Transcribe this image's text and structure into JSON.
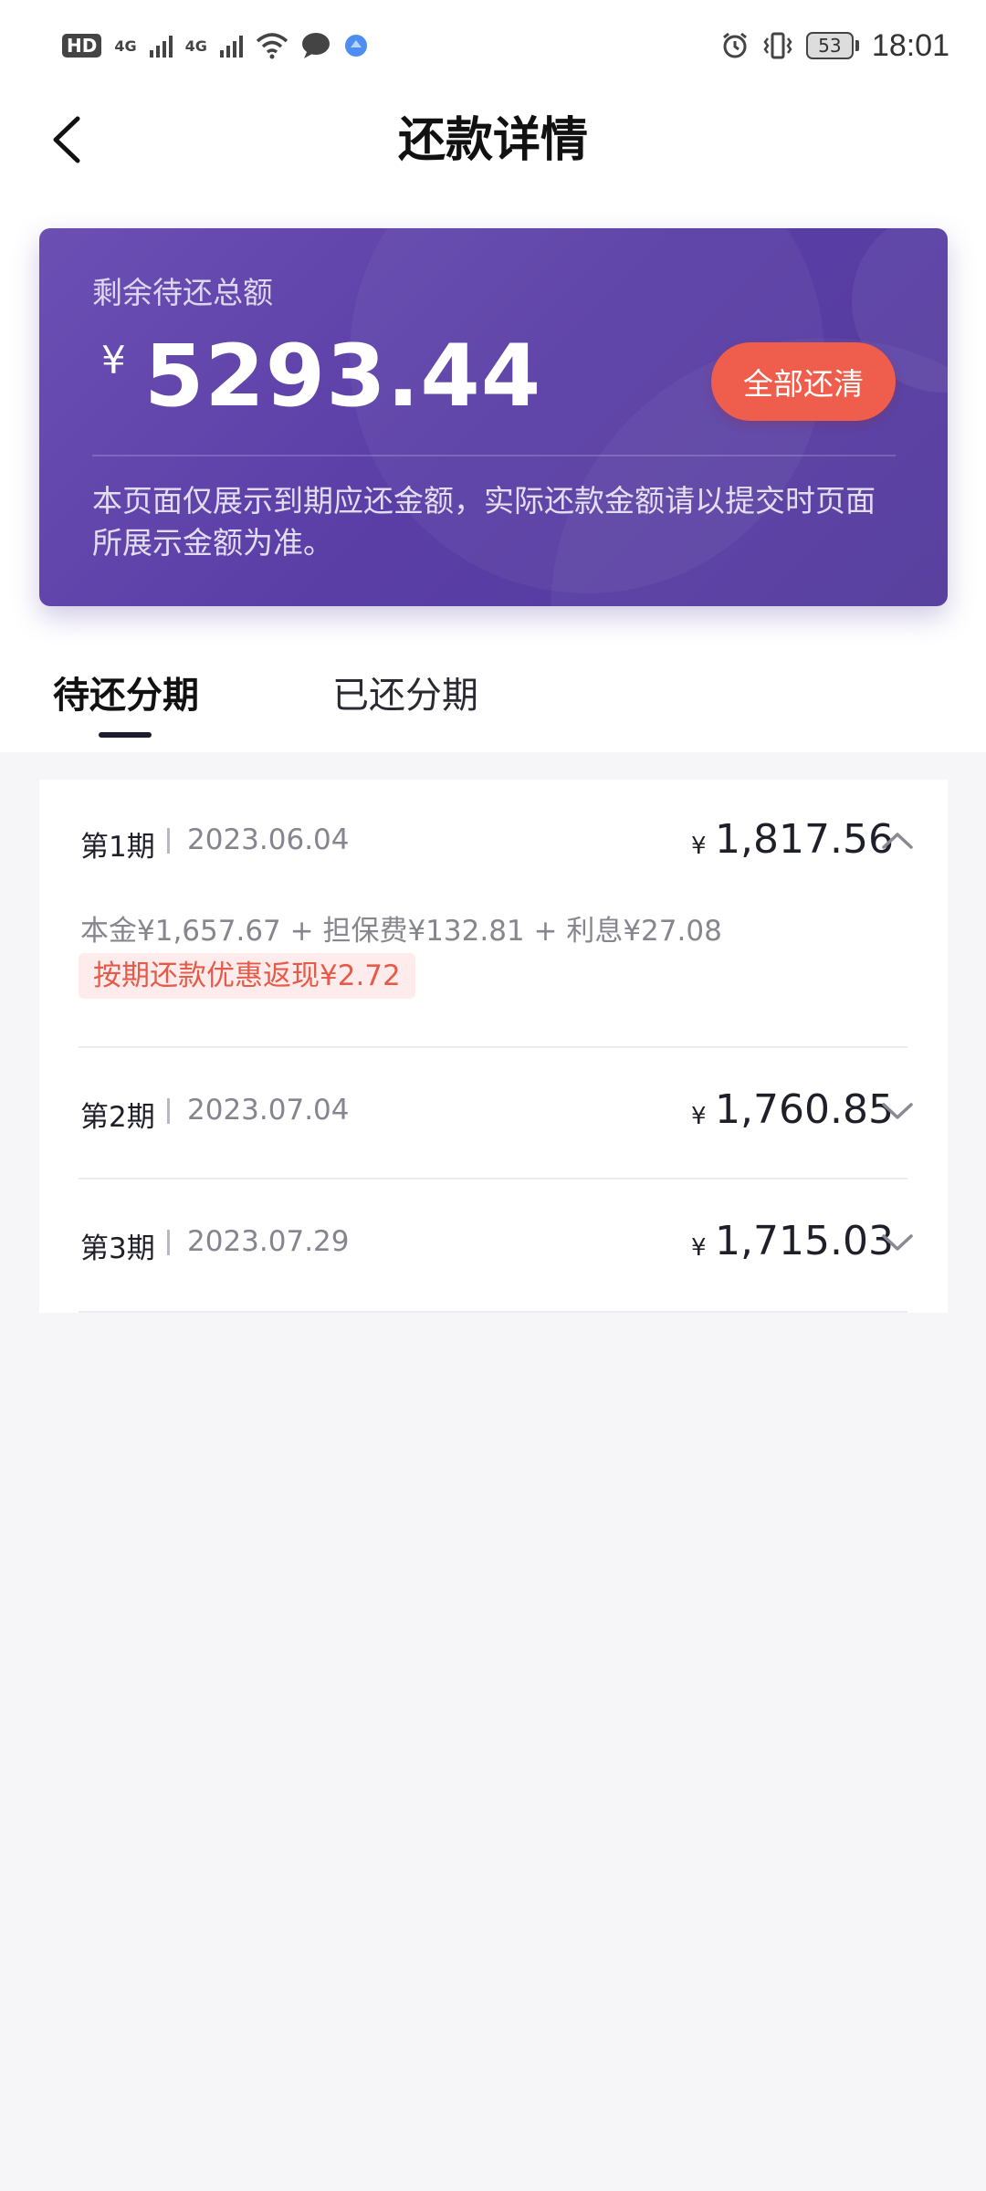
{
  "status_bar": {
    "hd": "HD",
    "net1": "4G",
    "net2": "4G",
    "battery_level": "53",
    "time": "18:01"
  },
  "header": {
    "title": "还款详情"
  },
  "summary": {
    "label": "剩余待还总额",
    "currency": "¥",
    "amount": "5293.44",
    "payoff_button": "全部还清",
    "note": "本页面仅展示到期应还金额，实际还款金额请以提交时页面所展示金额为准。"
  },
  "tabs": [
    {
      "label": "待还分期",
      "active": true
    },
    {
      "label": "已还分期",
      "active": false
    }
  ],
  "installments": [
    {
      "period": "第1期",
      "date": "2023.06.04",
      "currency": "¥",
      "amount": "1,817.56",
      "expanded": true,
      "breakdown": "本金¥1,657.67 + 担保费¥132.81 + 利息¥27.08",
      "discount": "按期还款优惠返现¥2.72"
    },
    {
      "period": "第2期",
      "date": "2023.07.04",
      "currency": "¥",
      "amount": "1,760.85",
      "expanded": false
    },
    {
      "period": "第3期",
      "date": "2023.07.29",
      "currency": "¥",
      "amount": "1,715.03",
      "expanded": false
    }
  ],
  "colors": {
    "card_primary": "#5a3ea6",
    "accent_red": "#ef5e4c",
    "discount_bg": "#fdeceb",
    "discount_text": "#e65a4a"
  }
}
